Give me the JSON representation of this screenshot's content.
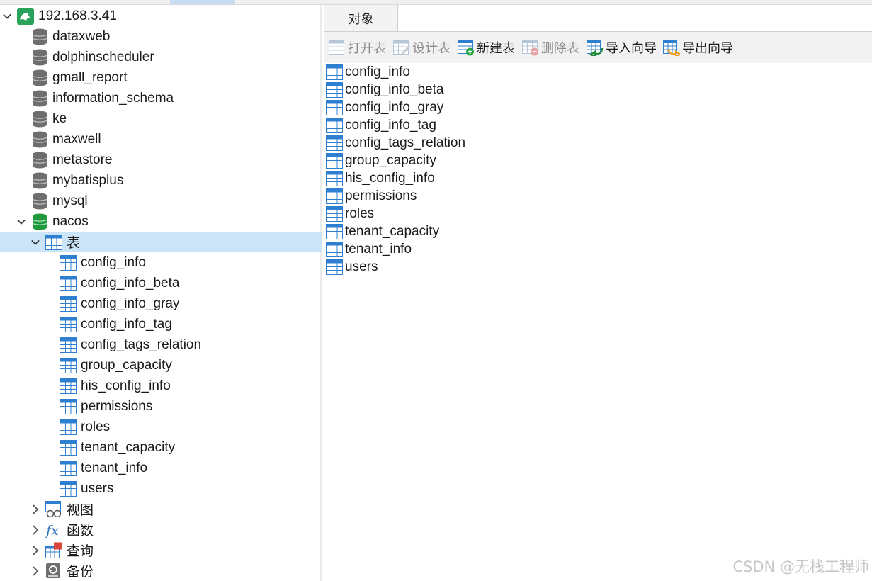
{
  "connection": {
    "name": "192.168.3.41"
  },
  "databases": [
    {
      "name": "dataxweb"
    },
    {
      "name": "dolphinscheduler"
    },
    {
      "name": "gmall_report"
    },
    {
      "name": "information_schema"
    },
    {
      "name": "ke"
    },
    {
      "name": "maxwell"
    },
    {
      "name": "metastore"
    },
    {
      "name": "mybatisplus"
    },
    {
      "name": "mysql"
    },
    {
      "name": "nacos"
    }
  ],
  "nacos_groups": {
    "tables": "表",
    "views": "视图",
    "functions": "函数",
    "queries": "查询",
    "backups": "备份"
  },
  "tables": [
    "config_info",
    "config_info_beta",
    "config_info_gray",
    "config_info_tag",
    "config_tags_relation",
    "group_capacity",
    "his_config_info",
    "permissions",
    "roles",
    "tenant_capacity",
    "tenant_info",
    "users"
  ],
  "tab": {
    "label": "对象"
  },
  "toolbar": {
    "open": "打开表",
    "design": "设计表",
    "new": "新建表",
    "delete": "删除表",
    "import": "导入向导",
    "export": "导出向导"
  },
  "watermark": "CSDN @无栈工程师",
  "colors": {
    "selection": "#cce4f7",
    "table_icon_blue": "#2f7fd0",
    "db_gray": "#6e6e6e",
    "db_green": "#1f9a3c",
    "conn_green": "#2aa35a"
  }
}
